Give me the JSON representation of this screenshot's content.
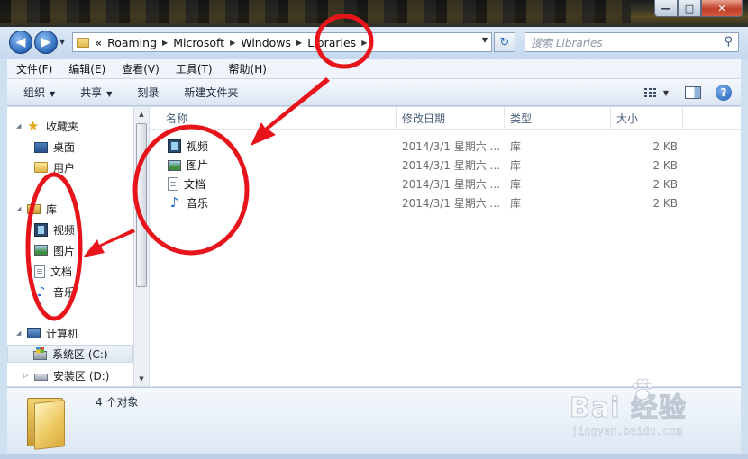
{
  "window": {
    "controls": {
      "minimize": "—",
      "maximize": "□",
      "close": "✕"
    }
  },
  "address_bar": {
    "overflow": "«",
    "segments": [
      "Roaming",
      "Microsoft",
      "Windows",
      "Libraries"
    ],
    "search_placeholder": "搜索 Libraries"
  },
  "menu": [
    "文件(F)",
    "编辑(E)",
    "查看(V)",
    "工具(T)",
    "帮助(H)"
  ],
  "toolbar": {
    "organize": "组织",
    "share": "共享",
    "burn": "刻录",
    "new_folder": "新建文件夹"
  },
  "nav": {
    "favorites": {
      "label": "收藏夹",
      "items": [
        "桌面",
        "用户"
      ]
    },
    "libraries": {
      "label": "库",
      "items": [
        "视频",
        "图片",
        "文档",
        "音乐"
      ]
    },
    "computer": {
      "label": "计算机",
      "items": [
        "系统区 (C:)",
        "安装区 (D:)"
      ]
    }
  },
  "columns": {
    "name": "名称",
    "date": "修改日期",
    "type": "类型",
    "size": "大小"
  },
  "files": [
    {
      "name": "视频",
      "icon": "video-library-icon",
      "date": "2014/3/1 星期六 ...",
      "type": "库",
      "size": "2 KB"
    },
    {
      "name": "图片",
      "icon": "picture-library-icon",
      "date": "2014/3/1 星期六 ...",
      "type": "库",
      "size": "2 KB"
    },
    {
      "name": "文档",
      "icon": "document-library-icon",
      "date": "2014/3/1 星期六 ...",
      "type": "库",
      "size": "2 KB"
    },
    {
      "name": "音乐",
      "icon": "music-library-icon",
      "date": "2014/3/1 星期六 ...",
      "type": "库",
      "size": "2 KB"
    }
  ],
  "details": {
    "count": "4 个对象"
  },
  "annotation_color": "#e8141b",
  "watermark": {
    "logo_text": "Bai 经验",
    "url": "jingyan.baidu.com"
  }
}
